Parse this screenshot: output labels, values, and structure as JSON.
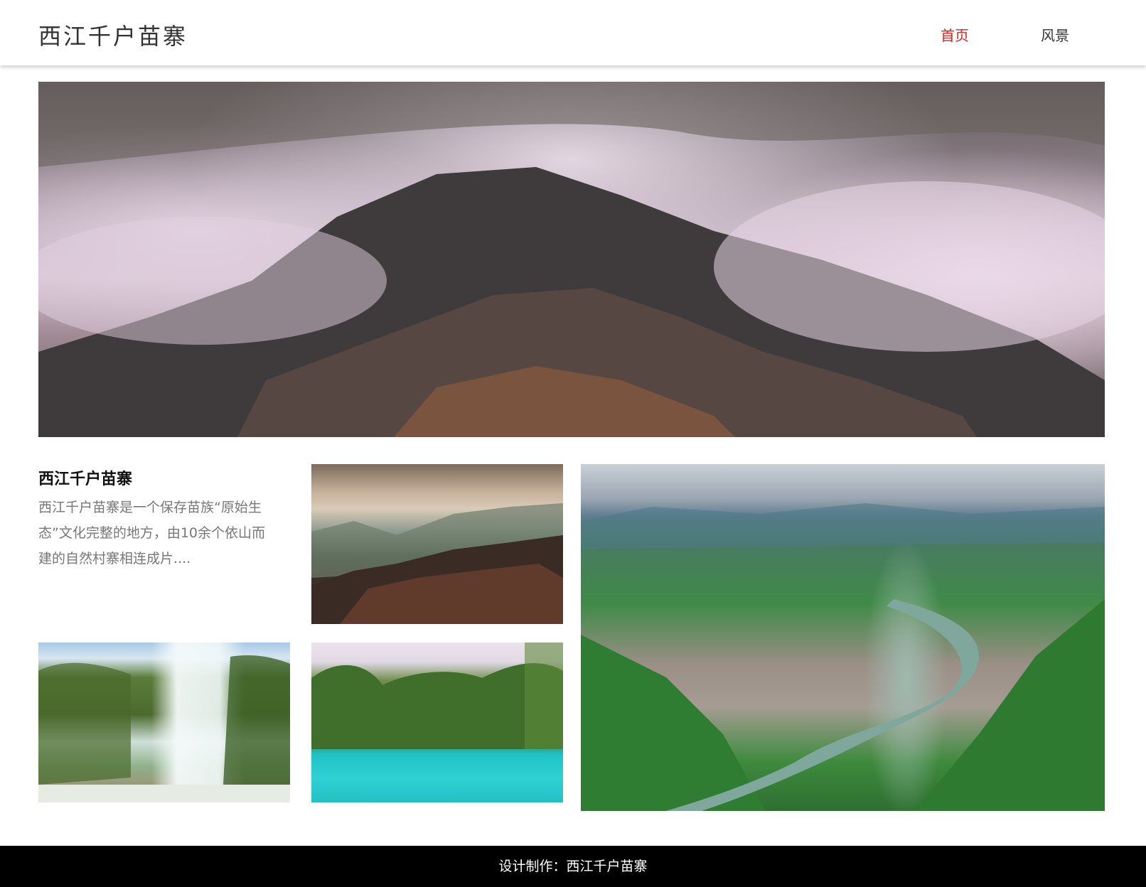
{
  "header": {
    "site_title": "西江千户苗寨",
    "nav": [
      {
        "label": "首页",
        "active": true
      },
      {
        "label": "风景",
        "active": false
      }
    ],
    "active_color": "#e0211a"
  },
  "intro": {
    "title": "西江千户苗寨",
    "description": "西江千户苗寨是一个保存苗族“原始生态”文化完整的地方，由10余个依山而建的自然村寨相连成片...."
  },
  "footer": {
    "text": "设计制作：西江千户苗寨"
  }
}
